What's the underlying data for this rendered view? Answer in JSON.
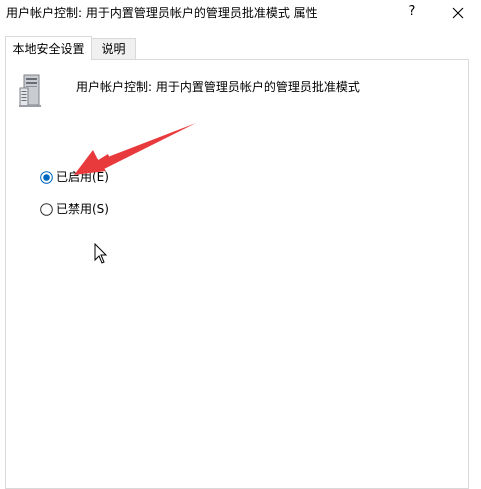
{
  "window": {
    "title": "用户帐户控制: 用于内置管理员帐户的管理员批准模式 属性",
    "help_label": "?",
    "close_icon": "close-icon"
  },
  "tabs": [
    {
      "label": "本地安全设置",
      "active": true
    },
    {
      "label": "说明",
      "active": false
    }
  ],
  "policy": {
    "icon": "server-policy-icon",
    "title": "用户帐户控制: 用于内置管理员帐户的管理员批准模式"
  },
  "options": [
    {
      "label": "已启用(E)",
      "selected": true
    },
    {
      "label": "已禁用(S)",
      "selected": false
    }
  ],
  "colors": {
    "arrow": "#e8393c",
    "radio_selected": "#0067c0",
    "border": "#d9d9d9"
  }
}
